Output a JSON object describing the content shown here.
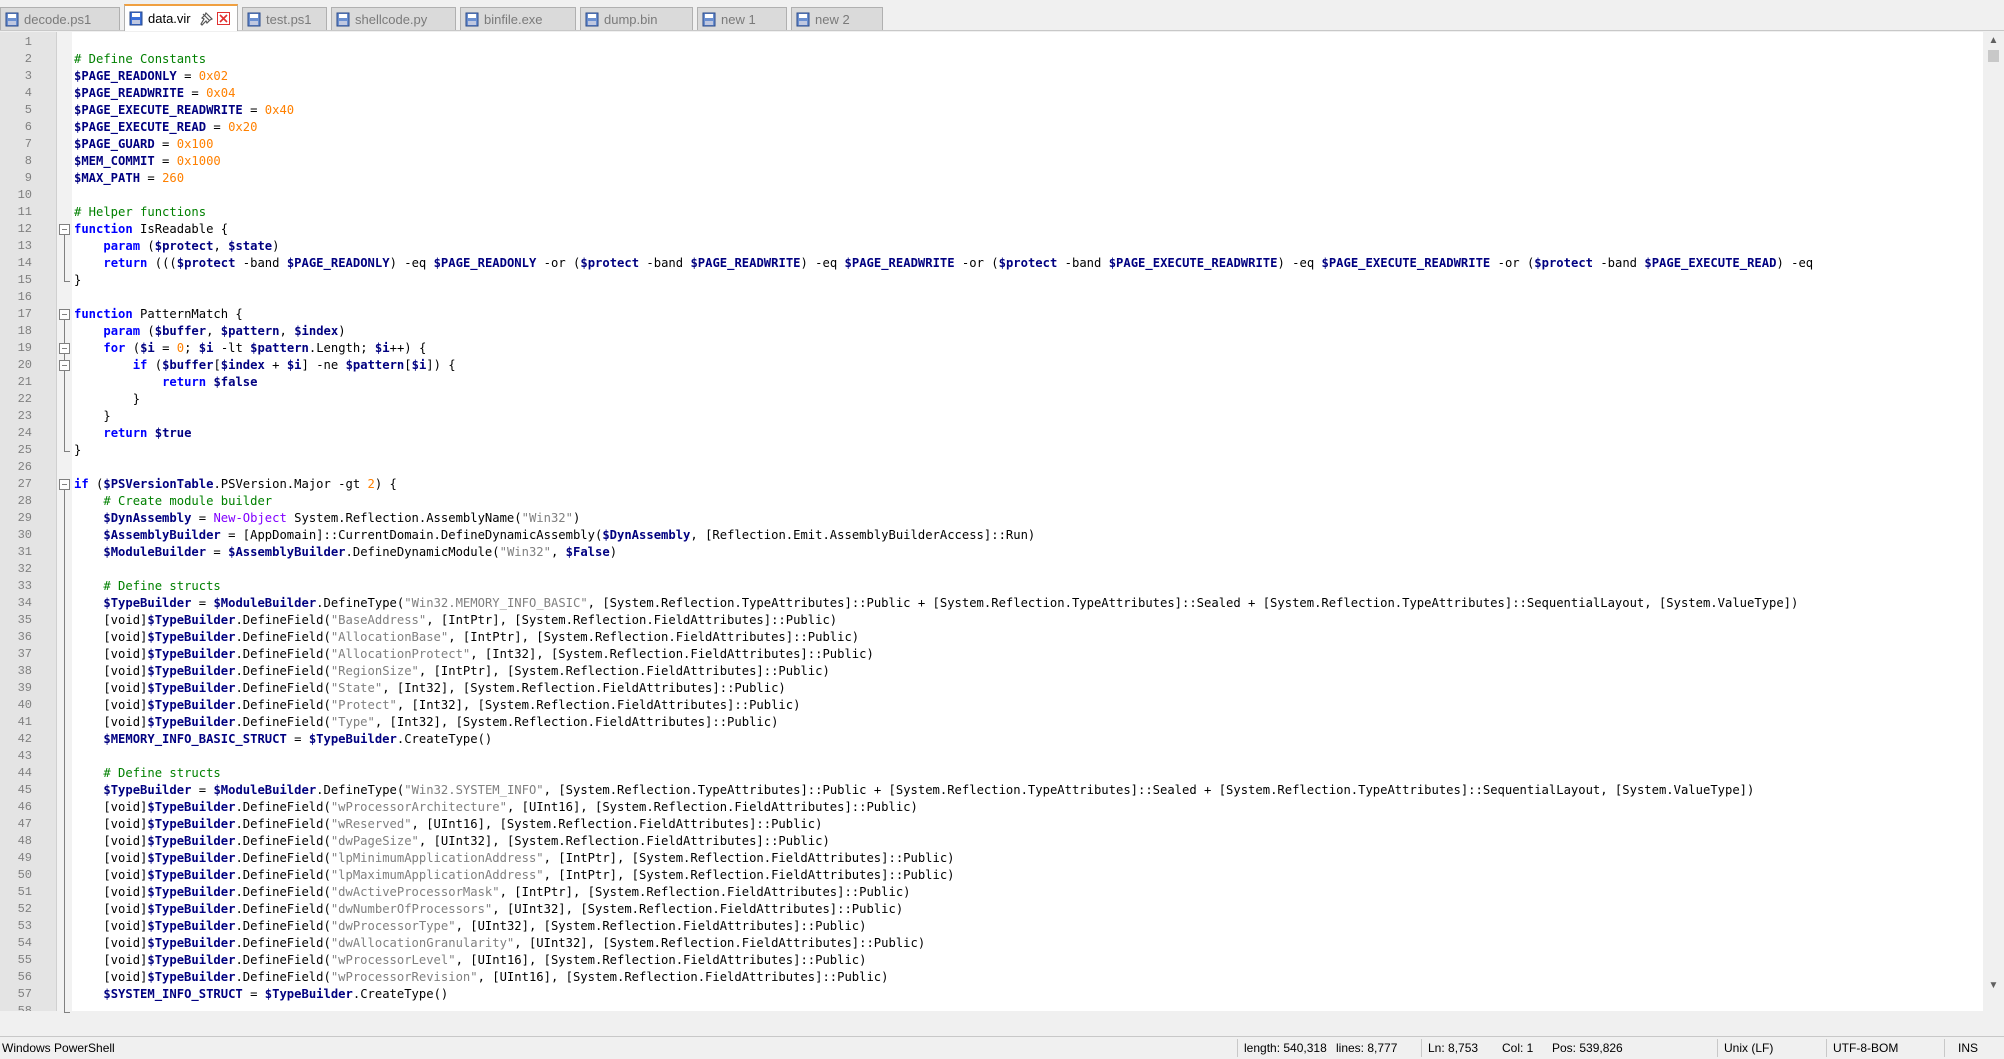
{
  "tabs": [
    {
      "label": "decode.ps1",
      "active": false
    },
    {
      "label": "data.vir",
      "active": true
    },
    {
      "label": "test.ps1",
      "active": false
    },
    {
      "label": "shellcode.py",
      "active": false
    },
    {
      "label": "binfile.exe",
      "active": false
    },
    {
      "label": "dump.bin",
      "active": false
    },
    {
      "label": "new 1",
      "active": false
    },
    {
      "label": "new 2",
      "active": false
    }
  ],
  "code_lines": [
    [],
    [
      [
        "c",
        "# Define Constants"
      ]
    ],
    [
      [
        "v",
        "$PAGE_READONLY"
      ],
      [
        "p",
        " = "
      ],
      [
        "n",
        "0x02"
      ]
    ],
    [
      [
        "v",
        "$PAGE_READWRITE"
      ],
      [
        "p",
        " = "
      ],
      [
        "n",
        "0x04"
      ]
    ],
    [
      [
        "v",
        "$PAGE_EXECUTE_READWRITE"
      ],
      [
        "p",
        " = "
      ],
      [
        "n",
        "0x40"
      ]
    ],
    [
      [
        "v",
        "$PAGE_EXECUTE_READ"
      ],
      [
        "p",
        " = "
      ],
      [
        "n",
        "0x20"
      ]
    ],
    [
      [
        "v",
        "$PAGE_GUARD"
      ],
      [
        "p",
        " = "
      ],
      [
        "n",
        "0x100"
      ]
    ],
    [
      [
        "v",
        "$MEM_COMMIT"
      ],
      [
        "p",
        " = "
      ],
      [
        "n",
        "0x1000"
      ]
    ],
    [
      [
        "v",
        "$MAX_PATH"
      ],
      [
        "p",
        " = "
      ],
      [
        "n",
        "260"
      ]
    ],
    [],
    [
      [
        "c",
        "# Helper functions"
      ]
    ],
    [
      [
        "k",
        "function"
      ],
      [
        "p",
        " IsReadable {"
      ]
    ],
    [
      [
        "p",
        "    "
      ],
      [
        "k",
        "param"
      ],
      [
        "p",
        " ("
      ],
      [
        "v",
        "$protect"
      ],
      [
        "p",
        ", "
      ],
      [
        "v",
        "$state"
      ],
      [
        "p",
        ")"
      ]
    ],
    [
      [
        "p",
        "    "
      ],
      [
        "k",
        "return"
      ],
      [
        "p",
        " ((("
      ],
      [
        "v",
        "$protect"
      ],
      [
        "p",
        " -band "
      ],
      [
        "v",
        "$PAGE_READONLY"
      ],
      [
        "p",
        ") -eq "
      ],
      [
        "v",
        "$PAGE_READONLY"
      ],
      [
        "p",
        " -or ("
      ],
      [
        "v",
        "$protect"
      ],
      [
        "p",
        " -band "
      ],
      [
        "v",
        "$PAGE_READWRITE"
      ],
      [
        "p",
        ") -eq "
      ],
      [
        "v",
        "$PAGE_READWRITE"
      ],
      [
        "p",
        " -or ("
      ],
      [
        "v",
        "$protect"
      ],
      [
        "p",
        " -band "
      ],
      [
        "v",
        "$PAGE_EXECUTE_READWRITE"
      ],
      [
        "p",
        ") -eq "
      ],
      [
        "v",
        "$PAGE_EXECUTE_READWRITE"
      ],
      [
        "p",
        " -or ("
      ],
      [
        "v",
        "$protect"
      ],
      [
        "p",
        " -band "
      ],
      [
        "v",
        "$PAGE_EXECUTE_READ"
      ],
      [
        "p",
        ") -eq"
      ]
    ],
    [
      [
        "p",
        "}"
      ]
    ],
    [],
    [
      [
        "k",
        "function"
      ],
      [
        "p",
        " PatternMatch {"
      ]
    ],
    [
      [
        "p",
        "    "
      ],
      [
        "k",
        "param"
      ],
      [
        "p",
        " ("
      ],
      [
        "v",
        "$buffer"
      ],
      [
        "p",
        ", "
      ],
      [
        "v",
        "$pattern"
      ],
      [
        "p",
        ", "
      ],
      [
        "v",
        "$index"
      ],
      [
        "p",
        ")"
      ]
    ],
    [
      [
        "p",
        "    "
      ],
      [
        "k",
        "for"
      ],
      [
        "p",
        " ("
      ],
      [
        "v",
        "$i"
      ],
      [
        "p",
        " = "
      ],
      [
        "n",
        "0"
      ],
      [
        "p",
        "; "
      ],
      [
        "v",
        "$i"
      ],
      [
        "p",
        " -lt "
      ],
      [
        "v",
        "$pattern"
      ],
      [
        "p",
        ".Length; "
      ],
      [
        "v",
        "$i"
      ],
      [
        "p",
        "++) {"
      ]
    ],
    [
      [
        "p",
        "        "
      ],
      [
        "k",
        "if"
      ],
      [
        "p",
        " ("
      ],
      [
        "v",
        "$buffer"
      ],
      [
        "p",
        "["
      ],
      [
        "v",
        "$index"
      ],
      [
        "p",
        " + "
      ],
      [
        "v",
        "$i"
      ],
      [
        "p",
        "] -ne "
      ],
      [
        "v",
        "$pattern"
      ],
      [
        "p",
        "["
      ],
      [
        "v",
        "$i"
      ],
      [
        "p",
        "]) {"
      ]
    ],
    [
      [
        "p",
        "            "
      ],
      [
        "k",
        "return"
      ],
      [
        "p",
        " "
      ],
      [
        "v",
        "$false"
      ]
    ],
    [
      [
        "p",
        "        }"
      ]
    ],
    [
      [
        "p",
        "    }"
      ]
    ],
    [
      [
        "p",
        "    "
      ],
      [
        "k",
        "return"
      ],
      [
        "p",
        " "
      ],
      [
        "v",
        "$true"
      ]
    ],
    [
      [
        "p",
        "}"
      ]
    ],
    [],
    [
      [
        "k",
        "if"
      ],
      [
        "p",
        " ("
      ],
      [
        "v",
        "$PSVersionTable"
      ],
      [
        "p",
        ".PSVersion.Major -gt "
      ],
      [
        "n",
        "2"
      ],
      [
        "p",
        ") {"
      ]
    ],
    [
      [
        "p",
        "    "
      ],
      [
        "c",
        "# Create module builder"
      ]
    ],
    [
      [
        "p",
        "    "
      ],
      [
        "v",
        "$DynAssembly"
      ],
      [
        "p",
        " = "
      ],
      [
        "cm",
        "New-Object"
      ],
      [
        "p",
        " System.Reflection.AssemblyName("
      ],
      [
        "s",
        "\"Win32\""
      ],
      [
        "p",
        ")"
      ]
    ],
    [
      [
        "p",
        "    "
      ],
      [
        "v",
        "$AssemblyBuilder"
      ],
      [
        "p",
        " = [AppDomain]::CurrentDomain.DefineDynamicAssembly("
      ],
      [
        "v",
        "$DynAssembly"
      ],
      [
        "p",
        ", [Reflection.Emit.AssemblyBuilderAccess]::Run)"
      ]
    ],
    [
      [
        "p",
        "    "
      ],
      [
        "v",
        "$ModuleBuilder"
      ],
      [
        "p",
        " = "
      ],
      [
        "v",
        "$AssemblyBuilder"
      ],
      [
        "p",
        ".DefineDynamicModule("
      ],
      [
        "s",
        "\"Win32\""
      ],
      [
        "p",
        ", "
      ],
      [
        "v",
        "$False"
      ],
      [
        "p",
        ")"
      ]
    ],
    [],
    [
      [
        "p",
        "    "
      ],
      [
        "c",
        "# Define structs"
      ]
    ],
    [
      [
        "p",
        "    "
      ],
      [
        "v",
        "$TypeBuilder"
      ],
      [
        "p",
        " = "
      ],
      [
        "v",
        "$ModuleBuilder"
      ],
      [
        "p",
        ".DefineType("
      ],
      [
        "s",
        "\"Win32.MEMORY_INFO_BASIC\""
      ],
      [
        "p",
        ", [System.Reflection.TypeAttributes]::Public + [System.Reflection.TypeAttributes]::Sealed + [System.Reflection.TypeAttributes]::SequentialLayout, [System.ValueType])"
      ]
    ],
    [
      [
        "p",
        "    [void]"
      ],
      [
        "v",
        "$TypeBuilder"
      ],
      [
        "p",
        ".DefineField("
      ],
      [
        "s",
        "\"BaseAddress\""
      ],
      [
        "p",
        ", [IntPtr], [System.Reflection.FieldAttributes]::Public)"
      ]
    ],
    [
      [
        "p",
        "    [void]"
      ],
      [
        "v",
        "$TypeBuilder"
      ],
      [
        "p",
        ".DefineField("
      ],
      [
        "s",
        "\"AllocationBase\""
      ],
      [
        "p",
        ", [IntPtr], [System.Reflection.FieldAttributes]::Public)"
      ]
    ],
    [
      [
        "p",
        "    [void]"
      ],
      [
        "v",
        "$TypeBuilder"
      ],
      [
        "p",
        ".DefineField("
      ],
      [
        "s",
        "\"AllocationProtect\""
      ],
      [
        "p",
        ", [Int32], [System.Reflection.FieldAttributes]::Public)"
      ]
    ],
    [
      [
        "p",
        "    [void]"
      ],
      [
        "v",
        "$TypeBuilder"
      ],
      [
        "p",
        ".DefineField("
      ],
      [
        "s",
        "\"RegionSize\""
      ],
      [
        "p",
        ", [IntPtr], [System.Reflection.FieldAttributes]::Public)"
      ]
    ],
    [
      [
        "p",
        "    [void]"
      ],
      [
        "v",
        "$TypeBuilder"
      ],
      [
        "p",
        ".DefineField("
      ],
      [
        "s",
        "\"State\""
      ],
      [
        "p",
        ", [Int32], [System.Reflection.FieldAttributes]::Public)"
      ]
    ],
    [
      [
        "p",
        "    [void]"
      ],
      [
        "v",
        "$TypeBuilder"
      ],
      [
        "p",
        ".DefineField("
      ],
      [
        "s",
        "\"Protect\""
      ],
      [
        "p",
        ", [Int32], [System.Reflection.FieldAttributes]::Public)"
      ]
    ],
    [
      [
        "p",
        "    [void]"
      ],
      [
        "v",
        "$TypeBuilder"
      ],
      [
        "p",
        ".DefineField("
      ],
      [
        "s",
        "\"Type\""
      ],
      [
        "p",
        ", [Int32], [System.Reflection.FieldAttributes]::Public)"
      ]
    ],
    [
      [
        "p",
        "    "
      ],
      [
        "v",
        "$MEMORY_INFO_BASIC_STRUCT"
      ],
      [
        "p",
        " = "
      ],
      [
        "v",
        "$TypeBuilder"
      ],
      [
        "p",
        ".CreateType()"
      ]
    ],
    [],
    [
      [
        "p",
        "    "
      ],
      [
        "c",
        "# Define structs"
      ]
    ],
    [
      [
        "p",
        "    "
      ],
      [
        "v",
        "$TypeBuilder"
      ],
      [
        "p",
        " = "
      ],
      [
        "v",
        "$ModuleBuilder"
      ],
      [
        "p",
        ".DefineType("
      ],
      [
        "s",
        "\"Win32.SYSTEM_INFO\""
      ],
      [
        "p",
        ", [System.Reflection.TypeAttributes]::Public + [System.Reflection.TypeAttributes]::Sealed + [System.Reflection.TypeAttributes]::SequentialLayout, [System.ValueType])"
      ]
    ],
    [
      [
        "p",
        "    [void]"
      ],
      [
        "v",
        "$TypeBuilder"
      ],
      [
        "p",
        ".DefineField("
      ],
      [
        "s",
        "\"wProcessorArchitecture\""
      ],
      [
        "p",
        ", [UInt16], [System.Reflection.FieldAttributes]::Public)"
      ]
    ],
    [
      [
        "p",
        "    [void]"
      ],
      [
        "v",
        "$TypeBuilder"
      ],
      [
        "p",
        ".DefineField("
      ],
      [
        "s",
        "\"wReserved\""
      ],
      [
        "p",
        ", [UInt16], [System.Reflection.FieldAttributes]::Public)"
      ]
    ],
    [
      [
        "p",
        "    [void]"
      ],
      [
        "v",
        "$TypeBuilder"
      ],
      [
        "p",
        ".DefineField("
      ],
      [
        "s",
        "\"dwPageSize\""
      ],
      [
        "p",
        ", [UInt32], [System.Reflection.FieldAttributes]::Public)"
      ]
    ],
    [
      [
        "p",
        "    [void]"
      ],
      [
        "v",
        "$TypeBuilder"
      ],
      [
        "p",
        ".DefineField("
      ],
      [
        "s",
        "\"lpMinimumApplicationAddress\""
      ],
      [
        "p",
        ", [IntPtr], [System.Reflection.FieldAttributes]::Public)"
      ]
    ],
    [
      [
        "p",
        "    [void]"
      ],
      [
        "v",
        "$TypeBuilder"
      ],
      [
        "p",
        ".DefineField("
      ],
      [
        "s",
        "\"lpMaximumApplicationAddress\""
      ],
      [
        "p",
        ", [IntPtr], [System.Reflection.FieldAttributes]::Public)"
      ]
    ],
    [
      [
        "p",
        "    [void]"
      ],
      [
        "v",
        "$TypeBuilder"
      ],
      [
        "p",
        ".DefineField("
      ],
      [
        "s",
        "\"dwActiveProcessorMask\""
      ],
      [
        "p",
        ", [IntPtr], [System.Reflection.FieldAttributes]::Public)"
      ]
    ],
    [
      [
        "p",
        "    [void]"
      ],
      [
        "v",
        "$TypeBuilder"
      ],
      [
        "p",
        ".DefineField("
      ],
      [
        "s",
        "\"dwNumberOfProcessors\""
      ],
      [
        "p",
        ", [UInt32], [System.Reflection.FieldAttributes]::Public)"
      ]
    ],
    [
      [
        "p",
        "    [void]"
      ],
      [
        "v",
        "$TypeBuilder"
      ],
      [
        "p",
        ".DefineField("
      ],
      [
        "s",
        "\"dwProcessorType\""
      ],
      [
        "p",
        ", [UInt32], [System.Reflection.FieldAttributes]::Public)"
      ]
    ],
    [
      [
        "p",
        "    [void]"
      ],
      [
        "v",
        "$TypeBuilder"
      ],
      [
        "p",
        ".DefineField("
      ],
      [
        "s",
        "\"dwAllocationGranularity\""
      ],
      [
        "p",
        ", [UInt32], [System.Reflection.FieldAttributes]::Public)"
      ]
    ],
    [
      [
        "p",
        "    [void]"
      ],
      [
        "v",
        "$TypeBuilder"
      ],
      [
        "p",
        ".DefineField("
      ],
      [
        "s",
        "\"wProcessorLevel\""
      ],
      [
        "p",
        ", [UInt16], [System.Reflection.FieldAttributes]::Public)"
      ]
    ],
    [
      [
        "p",
        "    [void]"
      ],
      [
        "v",
        "$TypeBuilder"
      ],
      [
        "p",
        ".DefineField("
      ],
      [
        "s",
        "\"wProcessorRevision\""
      ],
      [
        "p",
        ", [UInt16], [System.Reflection.FieldAttributes]::Public)"
      ]
    ],
    [
      [
        "p",
        "    "
      ],
      [
        "v",
        "$SYSTEM_INFO_STRUCT"
      ],
      [
        "p",
        " = "
      ],
      [
        "v",
        "$TypeBuilder"
      ],
      [
        "p",
        ".CreateType()"
      ]
    ],
    []
  ],
  "fold_markers": [
    12,
    17,
    19,
    20,
    27
  ],
  "fold_regions": [
    [
      12,
      15
    ],
    [
      17,
      25
    ],
    [
      27,
      58
    ]
  ],
  "status": {
    "language": "Windows PowerShell",
    "length": "length: 540,318",
    "lines": "lines: 8,777",
    "ln": "Ln: 8,753",
    "col": "Col: 1",
    "pos": "Pos: 539,826",
    "eol": "Unix (LF)",
    "encoding": "UTF-8-BOM",
    "mode": "INS"
  },
  "colors": {
    "keyword": "#0000ff",
    "variable": "#000080",
    "string": "#808080",
    "number": "#ff8000",
    "comment": "#008000",
    "cmdlet": "#8000ff",
    "active_tab_accent": "#f0a040"
  }
}
